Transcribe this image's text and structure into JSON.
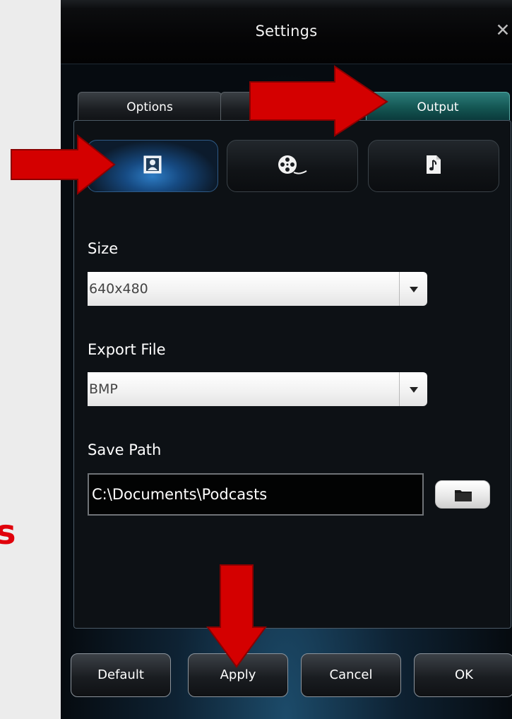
{
  "left_fragment": {
    "text": "s"
  },
  "window": {
    "title": "Settings"
  },
  "tabs": [
    {
      "label": "Options",
      "active": false
    },
    {
      "label": "",
      "active": false
    },
    {
      "label": "Output",
      "active": true
    }
  ],
  "subtabs": [
    {
      "icon": "picture-icon",
      "active": true
    },
    {
      "icon": "film-reel-icon",
      "active": false
    },
    {
      "icon": "music-file-icon",
      "active": false
    }
  ],
  "fields": {
    "size": {
      "label": "Size",
      "value": "640x480"
    },
    "export_file": {
      "label": "Export File",
      "value": "BMP"
    },
    "save_path": {
      "label": "Save Path",
      "value": "C:\\Documents\\Podcasts"
    }
  },
  "buttons": {
    "default": "Default",
    "apply": "Apply",
    "cancel": "Cancel",
    "ok": "OK"
  },
  "colors": {
    "annotation_arrow": "#d40000",
    "active_tab": "#145653",
    "active_subtab": "#2d7cc4"
  }
}
